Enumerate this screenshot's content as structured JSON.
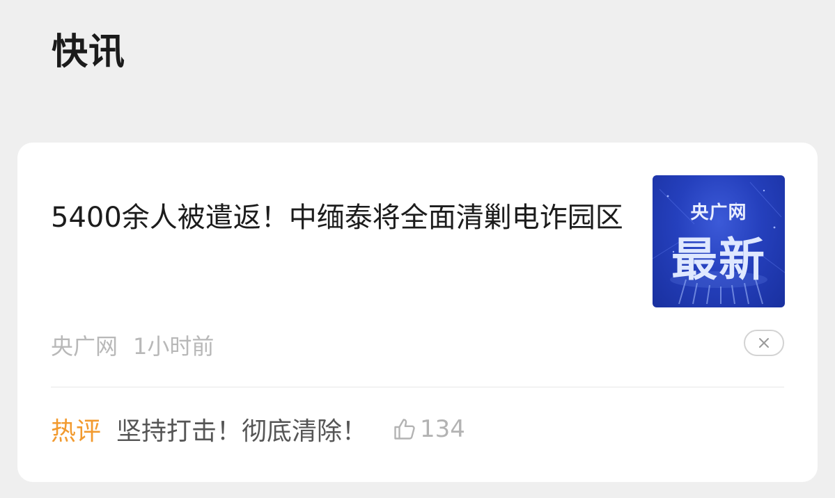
{
  "section": {
    "title": "快讯"
  },
  "article": {
    "headline": "5400余人被遣返！中缅泰将全面清剿电诈园区",
    "thumbnail": {
      "brand": "央广网",
      "word": "最新",
      "bg_color": "#2540bd"
    },
    "source": "央广网",
    "time": "1小时前",
    "close_icon": "close-icon",
    "hot_comment": {
      "label": "热评",
      "text": "坚持打击！彻底清除！",
      "like_icon": "thumbs-up-icon",
      "likes": "134"
    }
  },
  "colors": {
    "page_bg": "#efefef",
    "card_bg": "#ffffff",
    "hot_label": "#f29a2e",
    "meta_gray": "#b8b8b8"
  }
}
